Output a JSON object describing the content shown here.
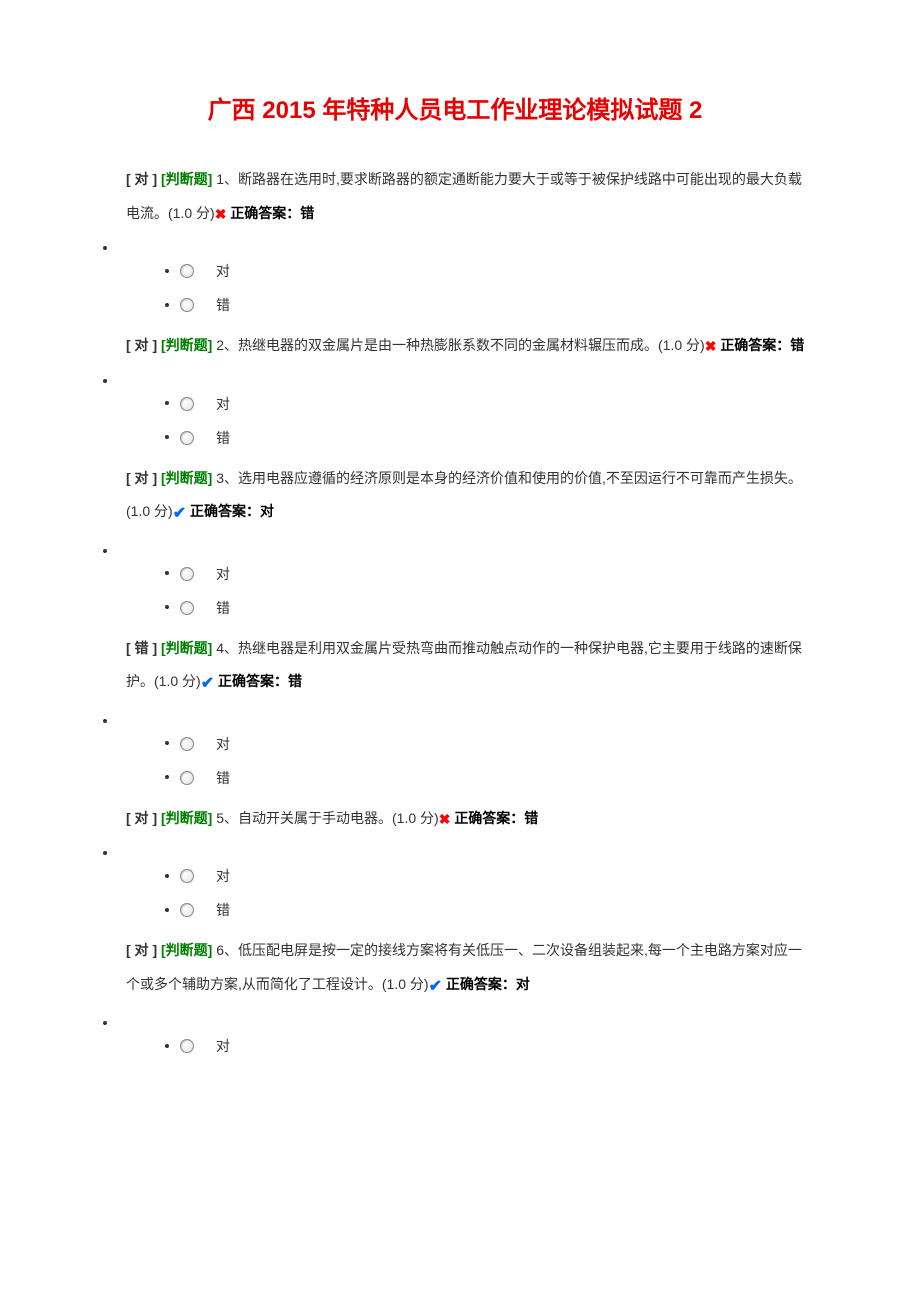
{
  "title": "广西 2015 年特种人员电工作业理论模拟试题 2",
  "option_true": "对",
  "option_false": "错",
  "questions": [
    {
      "user_answer_prefix": "[ 对 ]",
      "tag": "[判断题]",
      "body_before_mark": " 1、断路器在选用时,要求断路器的额定通断能力要大于或等于被保护线路中可能出现的最大负载电流。(1.0 分)",
      "mark": "wrong",
      "correct_answer": "正确答案：错"
    },
    {
      "user_answer_prefix": "[ 对 ]",
      "tag": "[判断题]",
      "body_before_mark": " 2、热继电器的双金属片是由一种热膨胀系数不同的金属材料辗压而成。(1.0 分)",
      "mark": "wrong",
      "correct_answer": "正确答案：错"
    },
    {
      "user_answer_prefix": "[ 对 ]",
      "tag": "[判断题]",
      "body_before_mark": " 3、选用电器应遵循的经济原则是本身的经济价值和使用的价值,不至因运行不可靠而产生损失。(1.0 分)",
      "mark": "right",
      "correct_answer": "正确答案：对"
    },
    {
      "user_answer_prefix": "[ 错 ]",
      "tag": "[判断题]",
      "body_before_mark": " 4、热继电器是利用双金属片受热弯曲而推动触点动作的一种保护电器,它主要用于线路的速断保护。(1.0 分)",
      "mark": "right",
      "correct_answer": "正确答案：错"
    },
    {
      "user_answer_prefix": "[ 对 ]",
      "tag": "[判断题]",
      "body_before_mark": " 5、自动开关属于手动电器。(1.0 分)",
      "mark": "wrong",
      "correct_answer": "正确答案：错"
    },
    {
      "user_answer_prefix": "[ 对 ]",
      "tag": "[判断题]",
      "body_before_mark": " 6、低压配电屏是按一定的接线方案将有关低压一、二次设备组装起来,每一个主电路方案对应一个或多个辅助方案,从而简化了工程设计。(1.0 分)",
      "mark": "right",
      "correct_answer": "正确答案：对"
    }
  ]
}
